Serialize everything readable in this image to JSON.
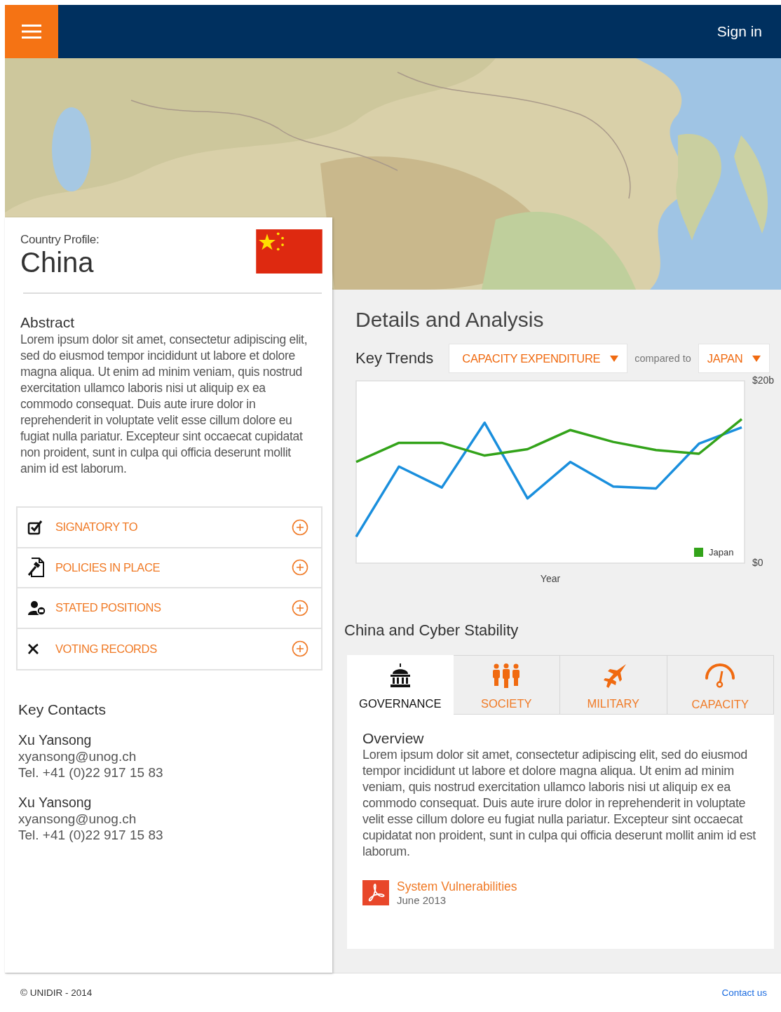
{
  "header": {
    "sign_in": "Sign in"
  },
  "profile": {
    "label": "Country Profile:",
    "country": "China"
  },
  "abstract": {
    "heading": "Abstract",
    "text": "Lorem ipsum dolor sit amet, consectetur adipiscing elit, sed do eiusmod tempor incididunt ut labore et dolore magna aliqua. Ut enim ad minim veniam, quis nostrud exercitation ullamco laboris nisi ut aliquip ex ea commodo consequat. Duis aute irure dolor in reprehenderit in voluptate velit esse cillum dolore eu fugiat nulla pariatur. Excepteur sint occaecat cupidatat non proident, sunt in culpa qui officia deserunt mollit anim id est laborum."
  },
  "accordion": [
    {
      "kind": "checkbox",
      "label": "SIGNATORY TO",
      "expanded": false
    },
    {
      "kind": "document",
      "label": "POLICIES IN PLACE",
      "expanded": false
    },
    {
      "kind": "person",
      "label": "STATED POSITIONS",
      "expanded": false
    },
    {
      "kind": "vote",
      "label": "VOTING RECORDS",
      "expanded": false
    }
  ],
  "contacts": {
    "heading": "Key Contacts",
    "people": [
      {
        "name": "Xu Yansong",
        "email": "xyansong@unog.ch",
        "phone": "Tel. +41 (0)22 917 15 83"
      },
      {
        "name": "Xu Yansong",
        "email": "xyansong@unog.ch",
        "phone": "Tel. +41 (0)22 917 15 83"
      }
    ]
  },
  "details": {
    "heading": "Details and Analysis",
    "key_trends": "Key Trends",
    "metric_select": "CAPACITY EXPENDITURE",
    "compared_label": "compared to",
    "country_select": "JAPAN",
    "chart_data": {
      "type": "line",
      "xlabel": "Year",
      "ylim": [
        0,
        20
      ],
      "yticks": [
        {
          "value": 20,
          "label": "$20b"
        },
        {
          "value": 0,
          "label": "$0"
        }
      ],
      "categories": [
        null,
        null,
        null,
        null,
        null,
        null,
        null,
        null,
        null,
        null
      ],
      "series": [
        {
          "color": "#1a8fdd",
          "values": [
            2.9,
            10.6,
            8.3,
            15.4,
            7.1,
            11.1,
            8.4,
            8.2,
            13.1,
            14.9
          ]
        },
        {
          "name": "Japan",
          "color": "#33a31a",
          "values": [
            11.1,
            13.2,
            13.2,
            11.8,
            12.5,
            14.6,
            13.3,
            12.4,
            12.0,
            15.8
          ]
        }
      ]
    }
  },
  "stability": {
    "heading": "China and Cyber Stability",
    "tabs": [
      {
        "kind": "governance",
        "label": "GOVERNANCE",
        "selected": true
      },
      {
        "kind": "society",
        "label": "SOCIETY",
        "selected": false
      },
      {
        "kind": "military",
        "label": "MILITARY",
        "selected": false
      },
      {
        "kind": "capacity",
        "label": "CAPACITY",
        "selected": false
      }
    ],
    "overview": {
      "heading": "Overview",
      "text": "Lorem ipsum dolor sit amet, consectetur adipiscing elit, sed do eiusmod tempor incididunt ut labore et dolore magna aliqua. Ut enim ad minim veniam, quis nostrud exercitation ullamco laboris nisi ut aliquip ex ea commodo consequat. Duis aute irure dolor in reprehenderit in voluptate velit esse cillum dolore eu fugiat nulla pariatur. Excepteur sint occaecat cupidatat non proident, sunt in culpa qui officia deserunt mollit anim id est laborum."
    },
    "document": {
      "title": "System Vulnerabilities",
      "date": "June 2013"
    }
  },
  "footer": {
    "copyright": "© UNIDIR - 2014",
    "contact": "Contact us"
  }
}
